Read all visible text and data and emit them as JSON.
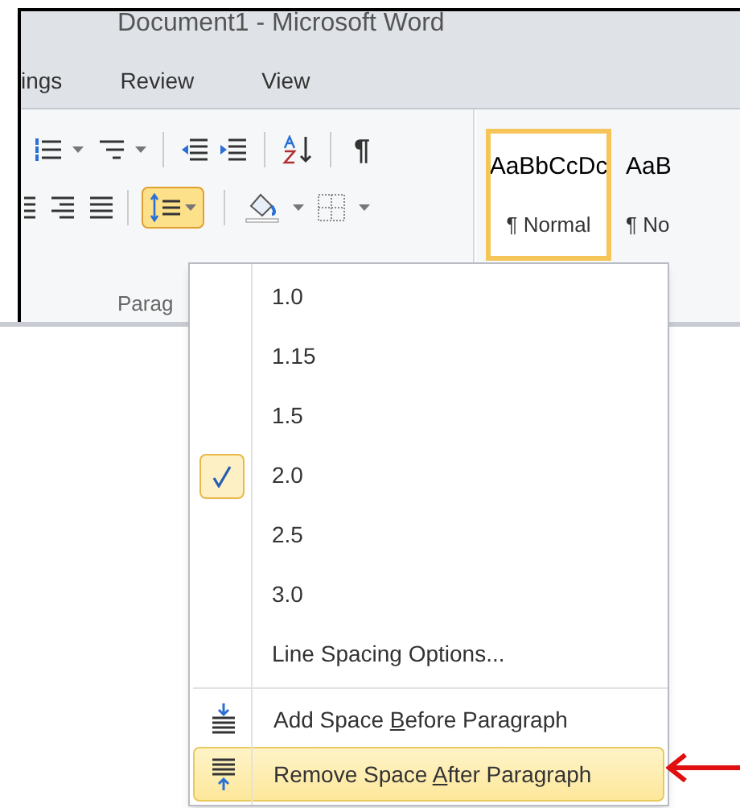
{
  "window": {
    "title": "Document1 - Microsoft Word"
  },
  "tabs": [
    {
      "label": "ings"
    },
    {
      "label": "Review"
    },
    {
      "label": "View"
    }
  ],
  "ribbon": {
    "pilcrow": "¶",
    "line_spacing_active": true,
    "group_label": "Parag",
    "styles": [
      {
        "preview": "AaBbCcDc",
        "name": "¶ Normal",
        "selected": true
      },
      {
        "preview": "AaB",
        "name": "¶ No",
        "selected": false
      }
    ]
  },
  "menu": {
    "items": [
      {
        "kind": "spacing",
        "label": "1.0",
        "checked": false
      },
      {
        "kind": "spacing",
        "label": "1.15",
        "checked": false
      },
      {
        "kind": "spacing",
        "label": "1.5",
        "checked": false
      },
      {
        "kind": "spacing",
        "label": "2.0",
        "checked": true
      },
      {
        "kind": "spacing",
        "label": "2.5",
        "checked": false
      },
      {
        "kind": "spacing",
        "label": "3.0",
        "checked": false
      },
      {
        "kind": "command",
        "label": "Line Spacing Options..."
      },
      {
        "kind": "space_before",
        "text_before": "Add Space ",
        "mnemonic": "B",
        "text_after": "efore Paragraph",
        "highlighted": false
      },
      {
        "kind": "space_after",
        "text_before": "Remove Space ",
        "mnemonic": "A",
        "text_after": "fter Paragraph",
        "highlighted": true
      }
    ]
  }
}
